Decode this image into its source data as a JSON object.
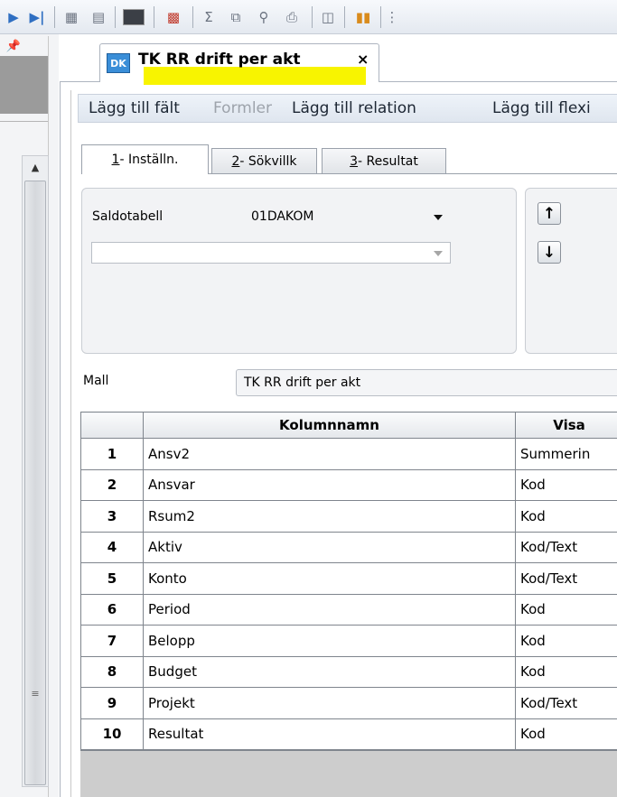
{
  "toolbar": {
    "icons": [
      "play-icon",
      "next-icon",
      "grid-icon",
      "form-icon",
      "color-icon",
      "chart-icon",
      "sum-icon",
      "copy-icon",
      "zoom-icon",
      "print-icon",
      "window-icon",
      "books-icon",
      "more-icon"
    ]
  },
  "left_pane": {
    "pin_glyph": "▫"
  },
  "document_tab": {
    "badge": "DK",
    "title": "TK RR drift per akt",
    "close_glyph": "×",
    "highlight_color": "#f8f400"
  },
  "menu": {
    "items": [
      {
        "label": "Lägg till fält",
        "enabled": true
      },
      {
        "label": "Formler",
        "enabled": false
      },
      {
        "label": "Lägg till relation",
        "enabled": true
      },
      {
        "label": "Lägg till flexi",
        "enabled": true
      }
    ]
  },
  "tabs": [
    {
      "key": "1",
      "label": " - Inställn.",
      "active": true
    },
    {
      "key": "2",
      "label": " - Sökvillk",
      "active": false
    },
    {
      "key": "3",
      "label": " - Resultat",
      "active": false
    }
  ],
  "settings": {
    "saldotabell_label": "Saldotabell",
    "saldotabell_value": "01DAKOM",
    "second_combo_value": "",
    "up_glyph": "↑",
    "down_glyph": "↓",
    "mall_label": "Mall",
    "mall_value": "TK RR drift per akt"
  },
  "grid": {
    "headers": [
      "",
      "Kolumnnamn",
      "Visa"
    ],
    "rows": [
      {
        "num": "1",
        "name": "Ansv2",
        "visa": "Summerin"
      },
      {
        "num": "2",
        "name": "Ansvar",
        "visa": "Kod"
      },
      {
        "num": "3",
        "name": "Rsum2",
        "visa": "Kod"
      },
      {
        "num": "4",
        "name": "Aktiv",
        "visa": "Kod/Text"
      },
      {
        "num": "5",
        "name": "Konto",
        "visa": "Kod/Text"
      },
      {
        "num": "6",
        "name": "Period",
        "visa": "Kod"
      },
      {
        "num": "7",
        "name": "Belopp",
        "visa": "Kod"
      },
      {
        "num": "8",
        "name": "Budget",
        "visa": "Kod"
      },
      {
        "num": "9",
        "name": "Projekt",
        "visa": "Kod/Text"
      },
      {
        "num": "10",
        "name": "Resultat",
        "visa": "Kod"
      }
    ]
  }
}
